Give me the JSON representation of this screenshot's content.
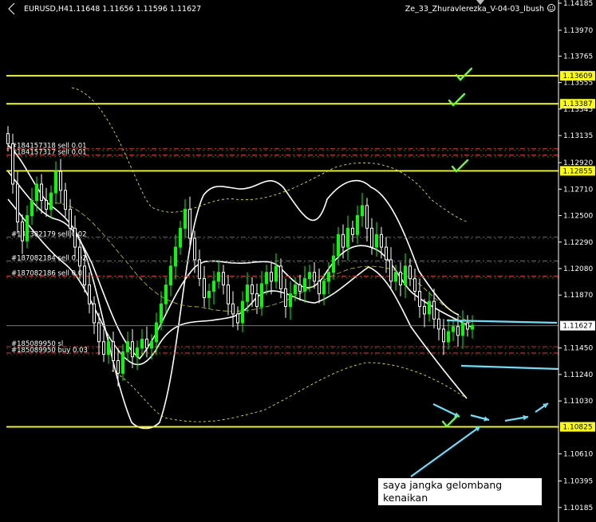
{
  "header": {
    "symbol": "EURUSD,H4",
    "ohlc": "1.11648 1.11656 1.11596 1.11627",
    "indicator": "Ze_33_Zhuravlerezka_V-04-03_Ibush"
  },
  "note": {
    "line1": "saya jangka gelombang",
    "line2": "kenaikan"
  },
  "colors": {
    "background": "#000000",
    "bull": "#00ff00",
    "bear": "#ffffff",
    "level": "#ffff00",
    "annotation": "#66e0ff",
    "check": "#66ff33",
    "order": "#ff3030"
  },
  "chart_data": {
    "type": "candlestick",
    "ylim": [
      1.1007,
      1.1421
    ],
    "y_ticks": [
      "1.14185",
      "1.13970",
      "1.13765",
      "1.13555",
      "1.13345",
      "1.13135",
      "1.12920",
      "1.12710",
      "1.12500",
      "1.12290",
      "1.12080",
      "1.11870",
      "1.11450",
      "1.11240",
      "1.11030",
      "1.10610",
      "1.10395",
      "1.10185"
    ],
    "current_price": "1.11627",
    "levels": [
      {
        "label": "1.13609",
        "price": 1.13609
      },
      {
        "label": "1.13387",
        "price": 1.13387
      },
      {
        "label": "1.12855",
        "price": 1.12855
      },
      {
        "label": "1.10825",
        "price": 1.10825
      }
    ],
    "orders": [
      {
        "label": "#184157318 sell 0.01",
        "price": 1.1303
      },
      {
        "label": "#184157317 sell 0.01",
        "price": 1.1298
      },
      {
        "label": "#187382179 sell 0.02",
        "price": 1.1233
      },
      {
        "label": "#187082184 sell 0.02",
        "price": 1.1214
      },
      {
        "label": "#187082186 sell 0.02",
        "price": 1.1202
      },
      {
        "label": "#185089950 sl",
        "price": 1.1146
      },
      {
        "label": "#185089950 buy 0.03",
        "price": 1.1141
      }
    ],
    "candles_close": [
      1.1307,
      1.1275,
      1.1245,
      1.123,
      1.125,
      1.1262,
      1.1275,
      1.1262,
      1.1255,
      1.1268,
      1.1285,
      1.127,
      1.1255,
      1.124,
      1.1225,
      1.121,
      1.1195,
      1.118,
      1.1165,
      1.115,
      1.114,
      1.115,
      1.1135,
      1.1125,
      1.1142,
      1.115,
      1.1138,
      1.1145,
      1.1152,
      1.1145,
      1.115,
      1.1165,
      1.118,
      1.1195,
      1.121,
      1.1225,
      1.124,
      1.1255,
      1.1232,
      1.1215,
      1.12,
      1.1185,
      1.119,
      1.1198,
      1.1205,
      1.1195,
      1.118,
      1.1172,
      1.1165,
      1.1182,
      1.1195,
      1.1188,
      1.1178,
      1.1196,
      1.1205,
      1.1198,
      1.121,
      1.1192,
      1.1178,
      1.1188,
      1.1195,
      1.119,
      1.12,
      1.1205,
      1.1198,
      1.1188,
      1.1198,
      1.1205,
      1.1218,
      1.1235,
      1.1225,
      1.124,
      1.1235,
      1.125,
      1.1258,
      1.124,
      1.1225,
      1.1235,
      1.1225,
      1.1215,
      1.1198,
      1.1205,
      1.1195,
      1.121,
      1.12,
      1.119,
      1.1178,
      1.1172,
      1.1182,
      1.1168,
      1.116,
      1.115,
      1.1158,
      1.1162,
      1.1155,
      1.1165,
      1.116,
      1.1163
    ]
  }
}
